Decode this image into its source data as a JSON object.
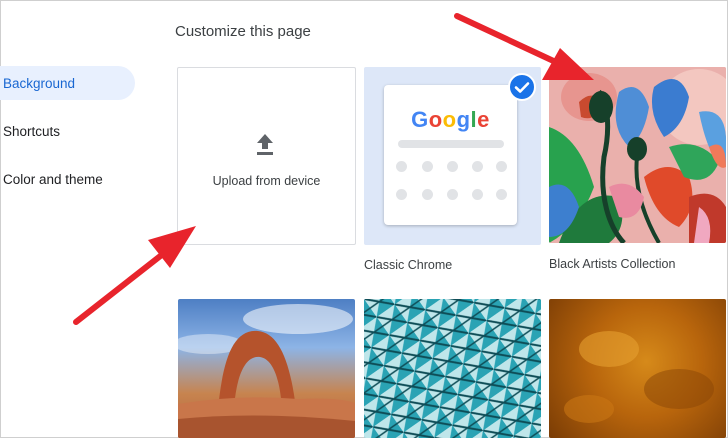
{
  "page": {
    "title": "Customize this page"
  },
  "sidebar": {
    "items": [
      {
        "label": "Background",
        "active": true
      },
      {
        "label": "Shortcuts",
        "active": false
      },
      {
        "label": "Color and theme",
        "active": false
      }
    ]
  },
  "tiles": {
    "upload": {
      "label": "Upload from device",
      "icon": "upload-icon"
    },
    "classic": {
      "caption": "Classic Chrome",
      "logo_text": "Google",
      "selected": true,
      "icon": "check-icon"
    },
    "collection": {
      "caption": "Black Artists Collection"
    }
  },
  "colors": {
    "accent": "#1a73e8",
    "active_nav_bg": "#e8f0fe",
    "annotation_arrow": "#e8242c",
    "google": [
      "#4285F4",
      "#EA4335",
      "#FBBC05",
      "#4285F4",
      "#34A853",
      "#EA4335"
    ]
  }
}
